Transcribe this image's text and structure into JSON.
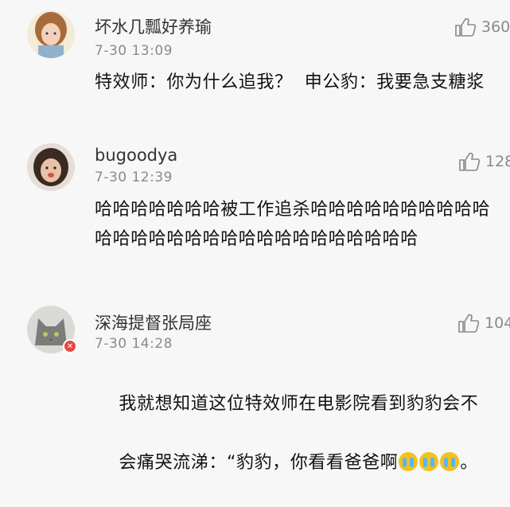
{
  "comments": [
    {
      "username": "坏水几瓢好养瑜",
      "time": "7-30 13:09",
      "likes": "360",
      "text": "特效师：你为什么追我？  申公豹：我要急支糖浆",
      "avatar_icon": "girl-avatar-icon"
    },
    {
      "username": "bugoodya",
      "time": "7-30 12:39",
      "likes": "128",
      "text": "哈哈哈哈哈哈哈被工作追杀哈哈哈哈哈哈哈哈哈哈哈哈哈哈哈哈哈哈哈哈哈哈哈哈哈哈哈哈",
      "avatar_icon": "child-avatar-icon"
    },
    {
      "username": "深海提督张局座",
      "time": "7-30 14:28",
      "likes": "104",
      "text_line1": "我就想知道这位特效师在电影院看到豹豹会不",
      "text_line2": "会痛哭流涕：“豹豹，你看看爸爸啊",
      "text_tail": "。",
      "emojis": [
        "crying-emoji",
        "crying-emoji",
        "crying-emoji"
      ],
      "avatar_icon": "cat-avatar-icon",
      "badge_icon": "vip-badge-icon"
    }
  ],
  "icons": {
    "like": "thumbs-up-icon"
  }
}
